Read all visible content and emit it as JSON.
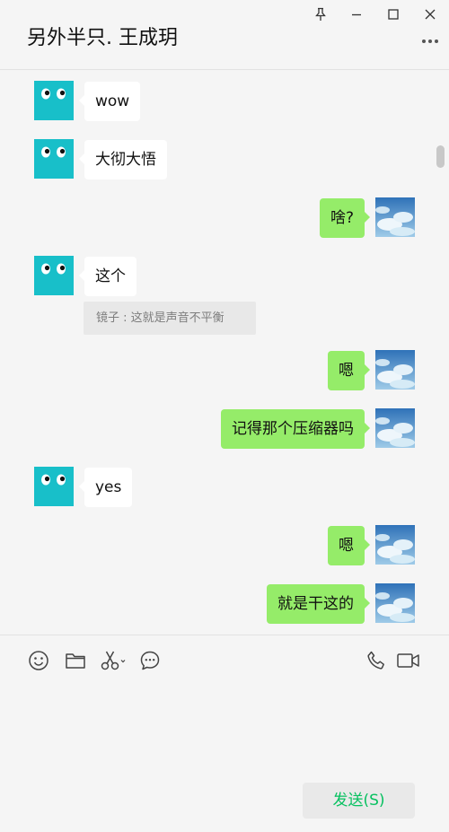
{
  "window": {
    "title": "另外半只. 王成玥",
    "controls": [
      "pin-icon",
      "minimize-icon",
      "maximize-icon",
      "close-icon"
    ],
    "more_icon": "more-icon"
  },
  "messages": [
    {
      "side": "in",
      "text": "wow"
    },
    {
      "side": "in",
      "text": "大彻大悟"
    },
    {
      "side": "out",
      "text": "啥?"
    },
    {
      "side": "in",
      "text": "这个",
      "quote": "镜子 : 这就是声音不平衡"
    },
    {
      "side": "out",
      "text": "嗯"
    },
    {
      "side": "out",
      "text": "记得那个压缩器吗"
    },
    {
      "side": "in",
      "text": "yes"
    },
    {
      "side": "out",
      "text": "嗯"
    },
    {
      "side": "out",
      "text": "就是干这的"
    }
  ],
  "toolbar": {
    "left": [
      "emoji-icon",
      "folder-icon",
      "screenshot-scissors-icon",
      "chat-history-icon"
    ],
    "right": [
      "voice-call-icon",
      "video-call-icon"
    ]
  },
  "composer": {
    "value": "",
    "send_label": "发送(S)"
  },
  "colors": {
    "background": "#f5f5f5",
    "incoming_bubble": "#ffffff",
    "outgoing_bubble": "#95ec69",
    "contact_avatar": "#18bfc9",
    "send_text": "#07c160",
    "quote_bg": "#e8e8e8"
  }
}
